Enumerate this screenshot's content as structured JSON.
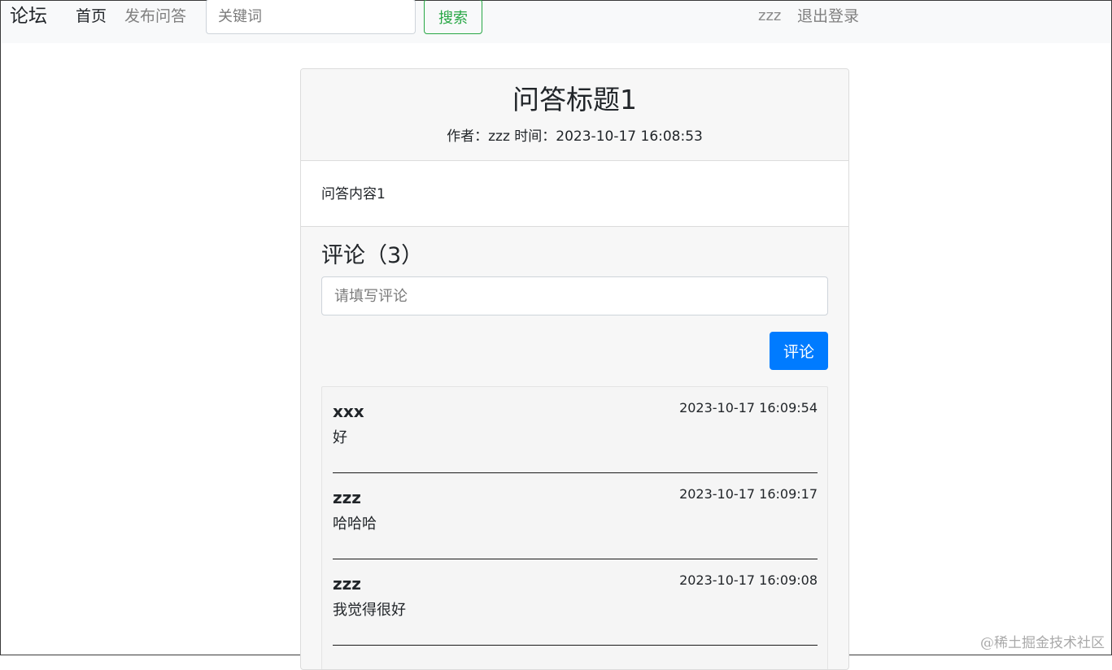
{
  "navbar": {
    "brand": "论坛",
    "home": "首页",
    "publish": "发布问答",
    "search_placeholder": "关键词",
    "search_button": "搜索",
    "username": "zzz",
    "logout": "退出登录"
  },
  "question": {
    "title": "问答标题1",
    "meta": "作者：zzz 时间：2023-10-17 16:08:53",
    "content": "问答内容1"
  },
  "comments_section": {
    "heading": "评论（3）",
    "input_placeholder": "请填写评论",
    "submit_label": "评论",
    "items": [
      {
        "author": "xxx",
        "time": "2023-10-17 16:09:54",
        "text": "好"
      },
      {
        "author": "zzz",
        "time": "2023-10-17 16:09:17",
        "text": "哈哈哈"
      },
      {
        "author": "zzz",
        "time": "2023-10-17 16:09:08",
        "text": "我觉得很好"
      }
    ]
  },
  "watermark": "@稀土掘金技术社区"
}
